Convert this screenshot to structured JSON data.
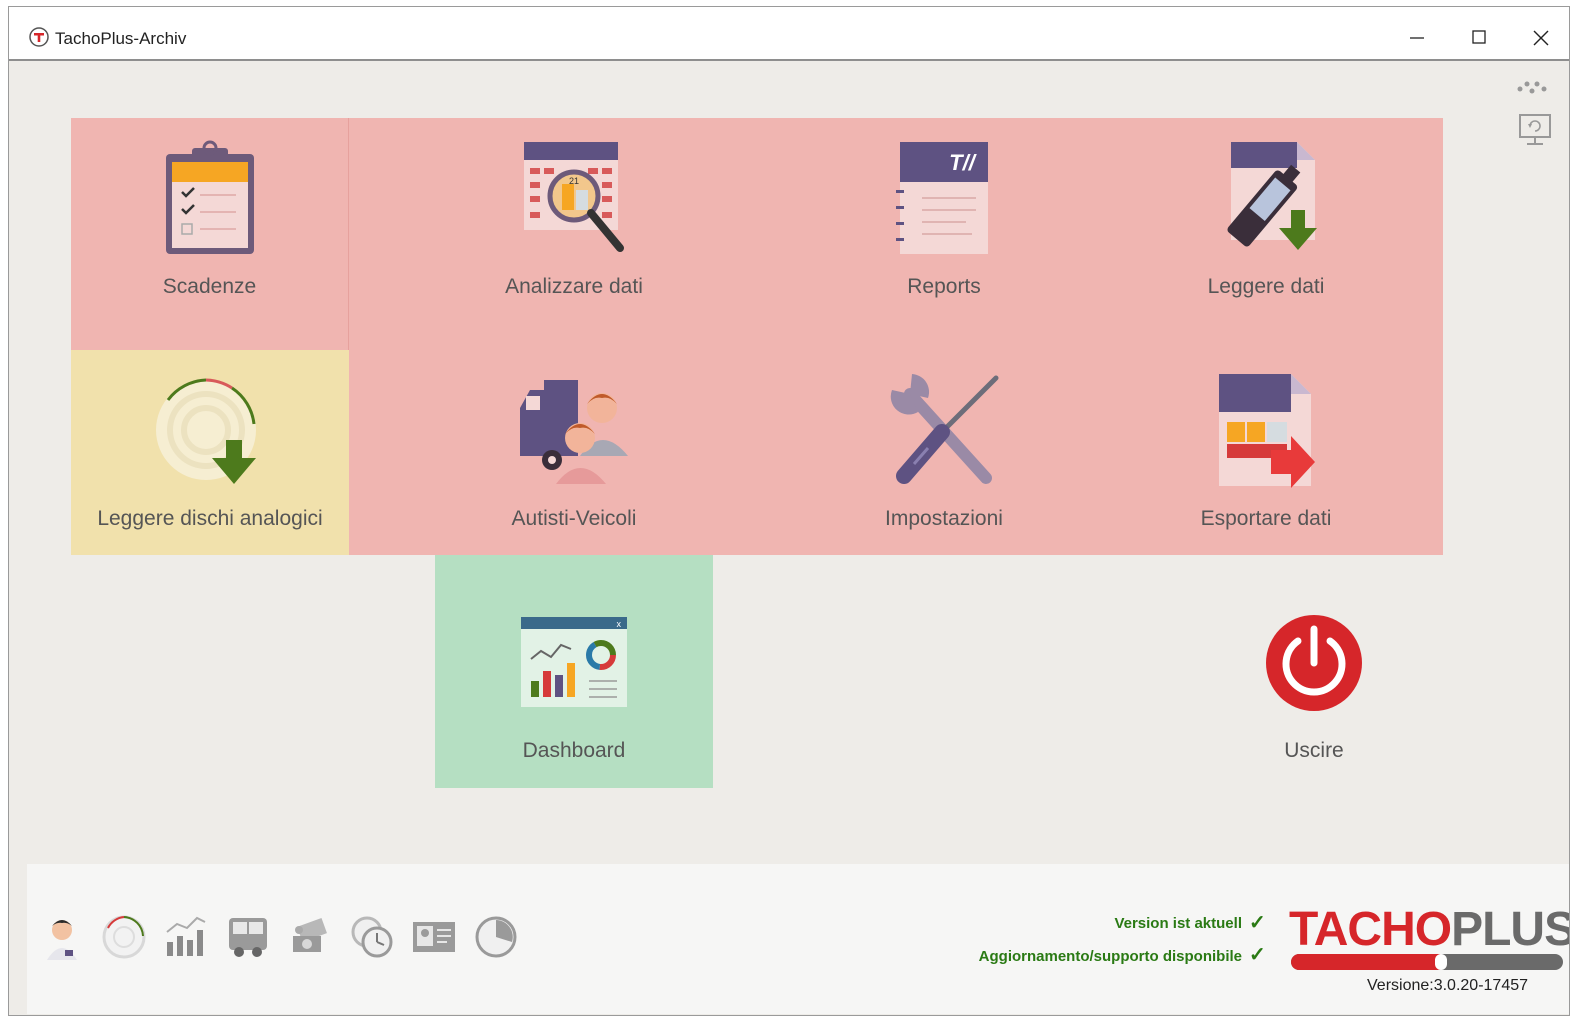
{
  "window": {
    "title": "TachoPlus-Archiv",
    "controls": [
      "minimize",
      "maximize",
      "close"
    ]
  },
  "tiles": [
    {
      "id": "scadenze",
      "label": "Scadenze",
      "icon": "clipboard-checklist-icon"
    },
    {
      "id": "analizzare",
      "label": "Analizzare dati",
      "icon": "calendar-magnifier-icon"
    },
    {
      "id": "reports",
      "label": "Reports",
      "icon": "report-notebook-icon"
    },
    {
      "id": "leggere",
      "label": "Leggere dati",
      "icon": "card-reader-download-icon"
    },
    {
      "id": "dischi",
      "label": "Leggere dischi analogici",
      "icon": "analog-disc-download-icon"
    },
    {
      "id": "autisti",
      "label": "Autisti-Veicoli",
      "icon": "truck-drivers-icon"
    },
    {
      "id": "impostazioni",
      "label": "Impostazioni",
      "icon": "wrench-screwdriver-icon"
    },
    {
      "id": "esportare",
      "label": "Esportare dati",
      "icon": "export-file-icon"
    },
    {
      "id": "dashboard",
      "label": "Dashboard",
      "icon": "dashboard-charts-icon"
    },
    {
      "id": "uscire",
      "label": "Uscire",
      "icon": "power-icon"
    }
  ],
  "footer": {
    "icons": [
      "driver-avatar-icon",
      "disc-icon",
      "bar-chart-icon",
      "bus-icon",
      "money-icon",
      "clocks-icon",
      "id-card-icon",
      "pie-chart-icon"
    ],
    "status_1": "Version ist aktuell",
    "status_2": "Aggiornamento/supporto disponibile",
    "check": "✓",
    "logo_part_1": "TACHO",
    "logo_part_2": "PLUS",
    "version": "Versione:3.0.20-17457"
  },
  "colors": {
    "tile_red": "#f0b5b1",
    "tile_yellow": "#f1e1ac",
    "tile_green": "#b5dfc2",
    "logo_red": "#d6262a",
    "logo_gray": "#6a6a6a",
    "status_green": "#2a7a14"
  }
}
